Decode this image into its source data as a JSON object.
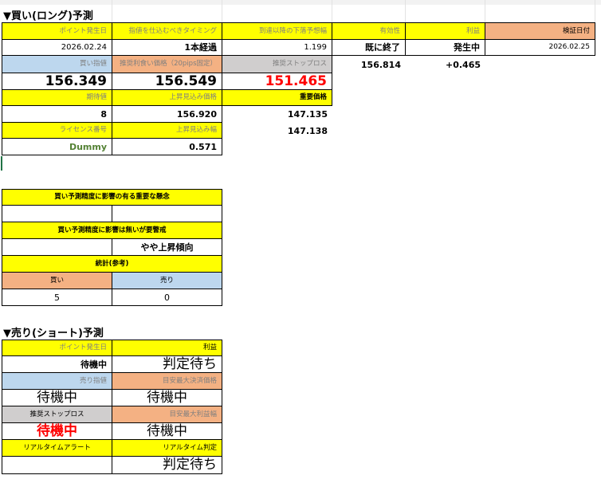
{
  "long": {
    "title": "▼買い(ロング)予測",
    "headers": {
      "point_date": "ポイント発生日",
      "entry_timing": "指値を仕込むべきタイミング",
      "drop_range": "到達以降の下落予想幅",
      "validity": "有効性",
      "profit": "利益",
      "verify_date": "検証日付"
    },
    "values": {
      "point_date": "2026.02.24",
      "entry_timing": "1本経過",
      "drop_range": "1.199",
      "validity": "既に終了",
      "profit": "発生中",
      "verify_date": "2026.02.25"
    },
    "row3": {
      "buy_limit_label": "買い指値",
      "take_profit_label": "推奨利食い価格（20pips固定）",
      "stop_loss_label": "推奨ストップロス",
      "current_price": "156.814",
      "profit_value": "+0.465"
    },
    "row4": {
      "buy_limit": "156.349",
      "take_profit": "156.549",
      "stop_loss": "151.465"
    },
    "row5": {
      "expected_label": "期待値",
      "upside_label": "上昇見込み価格",
      "key_price_label": "重要価格"
    },
    "row6": {
      "expected": "8",
      "upside": "156.920",
      "key_price_1": "147.135"
    },
    "row7": {
      "license_label": "ライセンス番号",
      "upside_range_label": "上昇見込み幅",
      "key_price_2": "147.138"
    },
    "row8": {
      "license": "Dummy",
      "upside_range": "0.571"
    }
  },
  "factors": {
    "important_label": "買い予測精度に影響の有る重要な懸念",
    "important_value": "",
    "minor_label": "買い予測精度に影響は無いが要警戒",
    "minor_value": "やや上昇傾向",
    "stats_label": "統計(参考)",
    "buy_label": "買い",
    "sell_label": "売り",
    "buy_count": "5",
    "sell_count": "0"
  },
  "short": {
    "title": "▼売り(ショート)予測",
    "point_date_label": "ポイント発生日",
    "profit_label": "利益",
    "point_date": "待機中",
    "profit": "判定待ち",
    "sell_limit_label": "売り指値",
    "max_settle_label": "目安最大決済価格",
    "sell_limit": "待機中",
    "max_settle": "待機中",
    "stop_loss_label": "推奨ストップロス",
    "max_profit_label": "目安最大利益幅",
    "stop_loss": "待機中",
    "max_profit": "待機中",
    "alert_label": "リアルタイムアラート",
    "realtime_label": "リアルタイム判定",
    "alert": "",
    "realtime": "判定待ち"
  },
  "colors": {
    "header_yellow": "#ffff00",
    "salmon": "#f4b183",
    "light_blue": "#bdd7ee",
    "gray": "#d0cece",
    "red": "#ff0000",
    "green": "#548235"
  }
}
